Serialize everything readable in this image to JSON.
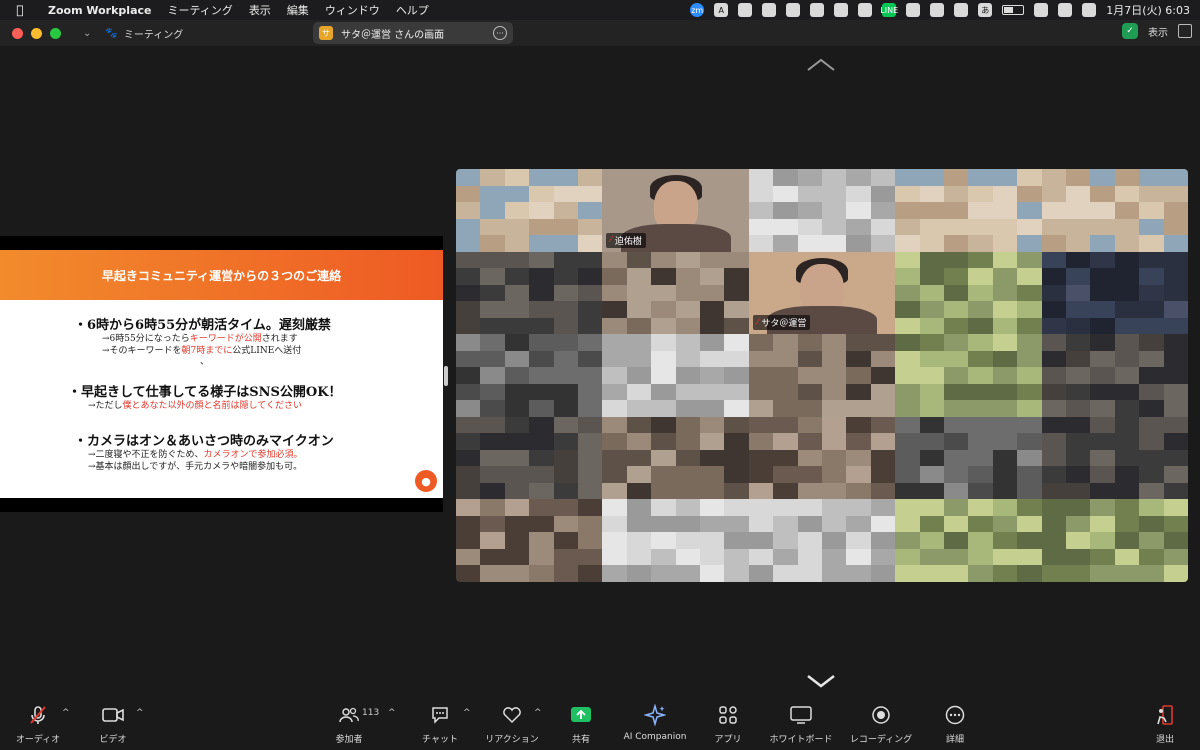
{
  "menubar": {
    "app": "Zoom Workplace",
    "items": [
      "ミーティング",
      "表示",
      "編集",
      "ウィンドウ",
      "ヘルプ"
    ],
    "tray": [
      "zm",
      "A",
      "",
      "",
      "",
      "",
      "",
      "",
      "LINE",
      "",
      "",
      "",
      "あ"
    ],
    "clock": "1月7日(火) 6:03"
  },
  "titlebar": {
    "meeting_label": "ミーティング",
    "share_title": "サタ＠運営 さんの画面",
    "share_avatar": "サ",
    "view_label": "表示"
  },
  "slide": {
    "title": "早起きコミュニティ運営からの３つのご連絡",
    "b1": "・6時から6時55分が朝活タイム。遅刻厳禁",
    "b1_s1_a": "→6時55分になったら",
    "b1_s1_r": "キーワードが公開",
    "b1_s1_b": "されます",
    "b1_s2_a": "→そのキーワードを",
    "b1_s2_r": "朝7時までに",
    "b1_s2_b": "公式LINEへ送付",
    "dot": "、",
    "b2": "・早起きして仕事してる様子はSNS公開OK！",
    "b2_s1_a": "→ただし",
    "b2_s1_r": "僕とあなた以外の顔と名前は隠してください",
    "b3": "・カメラはオン＆あいさつ時のみマイクオン",
    "b3_s1_a": "→二度寝や不正を防ぐため、",
    "b3_s1_r": "カメラオンで参加必須。",
    "b3_s2_a": "→基本は顔出しですが、手元カメラや暗闇参加も可。"
  },
  "gallery": {
    "names": [
      "迫佑樹",
      "サタ＠運営"
    ]
  },
  "toolbar": {
    "audio": "オーディオ",
    "video": "ビデオ",
    "participants": "参加者",
    "participant_count": "113",
    "chat": "チャット",
    "reaction": "リアクション",
    "share": "共有",
    "ai": "AI Companion",
    "apps": "アプリ",
    "whiteboard": "ホワイトボード",
    "recording": "レコーディング",
    "more": "詳細",
    "leave": "退出"
  },
  "colors": {
    "accent_orange": "#ee5a24",
    "share_green": "#1fbf63",
    "leave_red": "#e0392d"
  }
}
